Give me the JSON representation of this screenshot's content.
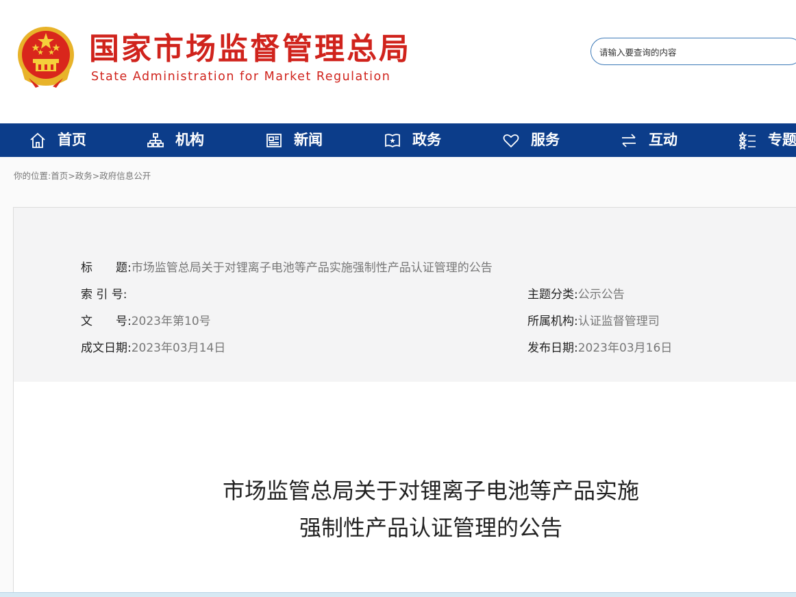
{
  "header": {
    "title_cn": "国家市场监督管理总局",
    "title_en": "State Administration for Market Regulation",
    "search_placeholder": "请输入要查询的内容"
  },
  "nav": [
    {
      "label": "首页",
      "icon": "home-icon"
    },
    {
      "label": "机构",
      "icon": "org-chart-icon"
    },
    {
      "label": "新闻",
      "icon": "newspaper-icon"
    },
    {
      "label": "政务",
      "icon": "book-icon"
    },
    {
      "label": "服务",
      "icon": "heart-icon"
    },
    {
      "label": "互动",
      "icon": "exchange-icon"
    },
    {
      "label": "专题",
      "icon": "topic-list-icon"
    }
  ],
  "breadcrumb": {
    "prefix": "你的位置:",
    "items": [
      "首页",
      "政务",
      "政府信息公开"
    ],
    "sep": ">"
  },
  "info": {
    "title_label": "标　　题:",
    "title_value": "市场监管总局关于对锂离子电池等产品实施强制性产品认证管理的公告",
    "index_label": "索 引 号:",
    "index_value": "",
    "doc_no_label": "文　　号:",
    "doc_no_value": "2023年第10号",
    "written_label": "成文日期:",
    "written_value": "2023年03月14日",
    "category_label": "主题分类:",
    "category_value": "公示公告",
    "agency_label": "所属机构:",
    "agency_value": "认证监督管理司",
    "published_label": "发布日期:",
    "published_value": "2023年03月16日"
  },
  "document": {
    "title_line1": "市场监管总局关于对锂离子电池等产品实施",
    "title_line2": "强制性产品认证管理的公告"
  },
  "colors": {
    "brand_red": "#d0231c",
    "nav_blue": "#0c3d8a"
  }
}
